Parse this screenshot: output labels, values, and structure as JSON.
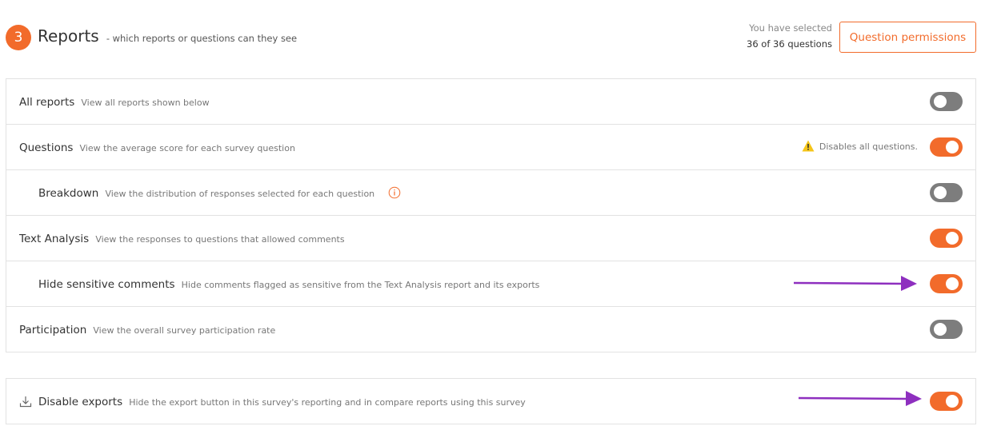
{
  "header": {
    "step": "3",
    "title": "Reports",
    "subtitle": "- which reports or questions can they see",
    "selected_line1": "You have selected",
    "selected_line2": "36 of 36 questions",
    "permissions_button": "Question permissions"
  },
  "rows": [
    {
      "label": "All reports",
      "description": "View all reports shown below",
      "enabled": false
    },
    {
      "label": "Questions",
      "description": "View the average score for each survey question",
      "enabled": true,
      "warning": "Disables all questions."
    },
    {
      "label": "Breakdown",
      "description": "View the distribution of responses selected for each question",
      "enabled": false,
      "info_icon": "info-icon"
    },
    {
      "label": "Text Analysis",
      "description": "View the responses to questions that allowed comments",
      "enabled": true
    },
    {
      "label": "Hide sensitive comments",
      "description": "Hide comments flagged as sensitive from the Text Analysis report and its exports",
      "enabled": true
    },
    {
      "label": "Participation",
      "description": "View the overall survey participation rate",
      "enabled": false
    }
  ],
  "export_row": {
    "icon": "download-icon",
    "label": "Disable exports",
    "description": "Hide the export button in this survey's reporting and in compare reports using this survey",
    "enabled": true
  },
  "colors": {
    "accent": "#f26b2b",
    "toggle_off": "#7d7d7d",
    "warning": "#f5c518",
    "annotation_arrow": "#8e2fbf"
  }
}
